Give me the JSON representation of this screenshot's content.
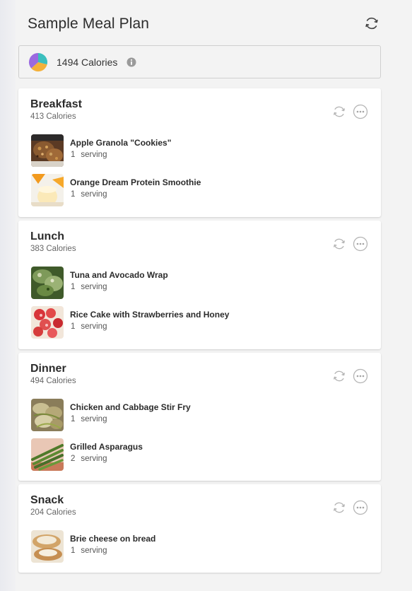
{
  "header": {
    "title": "Sample Meal Plan"
  },
  "summary": {
    "calories_text": "1494 Calories"
  },
  "colors": {
    "pie_purple": "#9b6ae0",
    "pie_teal": "#3bbfbe",
    "pie_orange": "#f4b13a",
    "icon_gray": "#b5b5b5",
    "accent": "#2b2b2b"
  },
  "meals": [
    {
      "title": "Breakfast",
      "calories": "413 Calories",
      "items": [
        {
          "name": "Apple Granola \"Cookies\"",
          "qty": "1",
          "unit": "serving",
          "thumb": "granola-cookies"
        },
        {
          "name": "Orange Dream Protein Smoothie",
          "qty": "1",
          "unit": "serving",
          "thumb": "orange-smoothie"
        }
      ]
    },
    {
      "title": "Lunch",
      "calories": "383 Calories",
      "items": [
        {
          "name": "Tuna and Avocado Wrap",
          "qty": "1",
          "unit": "serving",
          "thumb": "tuna-wrap"
        },
        {
          "name": "Rice Cake with Strawberries and Honey",
          "qty": "1",
          "unit": "serving",
          "thumb": "strawberries"
        }
      ]
    },
    {
      "title": "Dinner",
      "calories": "494 Calories",
      "items": [
        {
          "name": "Chicken and Cabbage Stir Fry",
          "qty": "1",
          "unit": "serving",
          "thumb": "stir-fry"
        },
        {
          "name": "Grilled Asparagus",
          "qty": "2",
          "unit": "serving",
          "thumb": "asparagus"
        }
      ]
    },
    {
      "title": "Snack",
      "calories": "204 Calories",
      "items": [
        {
          "name": "Brie cheese on bread",
          "qty": "1",
          "unit": "serving",
          "thumb": "brie-bread"
        }
      ]
    }
  ]
}
